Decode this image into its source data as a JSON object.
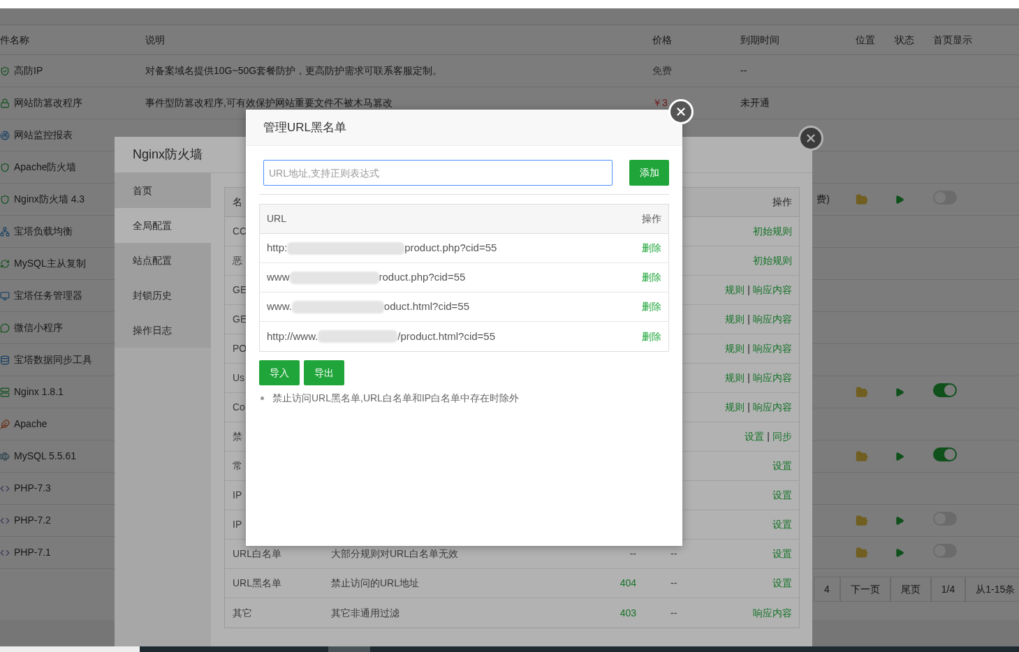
{
  "background_table": {
    "columns": [
      "件名称",
      "说明",
      "价格",
      "到期时间",
      "位置",
      "状态",
      "首页显示"
    ],
    "rows": [
      {
        "name": "高防IP",
        "description": "对备案域名提供10G~50G套餐防护，更高防护需求可联系客服定制。",
        "price": {
          "text": "免费",
          "paid": false
        },
        "expiry": "--",
        "installed": false
      },
      {
        "name": "网站防篡改程序",
        "description": "事件型防篡改程序,可有效保护网站重要文件不被木马篡改",
        "price": {
          "text": "￥3",
          "paid": true
        },
        "expiry": "未开通",
        "installed": false
      },
      {
        "name": "网站监控报表",
        "installed": false
      },
      {
        "name": "Apache防火墙",
        "installed": false
      },
      {
        "name": "Nginx防火墙 4.3",
        "expiry_tail": "费)",
        "installed": true,
        "home_display_on": false
      },
      {
        "name": "宝塔负载均衡",
        "installed": false
      },
      {
        "name": "MySQL主从复制",
        "installed": false
      },
      {
        "name": "宝塔任务管理器",
        "installed": false
      },
      {
        "name": "微信小程序",
        "installed": false
      },
      {
        "name": "宝塔数据同步工具",
        "installed": false
      },
      {
        "name": "Nginx 1.8.1",
        "installed": true,
        "home_display_on": true
      },
      {
        "name": "Apache",
        "installed": false
      },
      {
        "name": "MySQL 5.5.61",
        "installed": true,
        "home_display_on": true
      },
      {
        "name": "PHP-7.3",
        "installed": false
      },
      {
        "name": "PHP-7.2",
        "installed": true,
        "home_display_on": false
      },
      {
        "name": "PHP-7.1",
        "installed": true,
        "home_display_on": false
      }
    ]
  },
  "pagination": [
    {
      "label": "4"
    },
    {
      "label": "下一页"
    },
    {
      "label": "尾页"
    },
    {
      "label": "1/4"
    },
    {
      "label": "从1-15条"
    }
  ],
  "firewall_dialog": {
    "title": "Nginx防火墙",
    "nav": [
      {
        "label": "首页",
        "selected": false
      },
      {
        "label": "全局配置",
        "selected": true
      },
      {
        "label": "站点配置",
        "selected": false
      },
      {
        "label": "封锁历史",
        "selected": false
      },
      {
        "label": "操作日志",
        "selected": false
      }
    ],
    "table": {
      "name_header": "名",
      "actions_header": "操作",
      "action_separator": "|",
      "rows": [
        {
          "name": "CC",
          "actions": [
            "初始规则"
          ]
        },
        {
          "name": "恶",
          "actions": [
            "初始规则"
          ]
        },
        {
          "name": "GE",
          "actions": [
            "规则",
            "响应内容"
          ]
        },
        {
          "name": "GE",
          "actions": [
            "规则",
            "响应内容"
          ]
        },
        {
          "name": "PO",
          "actions": [
            "规则",
            "响应内容"
          ]
        },
        {
          "name": "Us",
          "actions": [
            "规则",
            "响应内容"
          ]
        },
        {
          "name": "Co",
          "actions": [
            "规则",
            "响应内容"
          ]
        },
        {
          "name": "禁",
          "actions": [
            "设置",
            "同步"
          ]
        },
        {
          "name": "常",
          "actions": [
            "设置"
          ]
        },
        {
          "name": "IP",
          "actions": [
            "设置"
          ]
        },
        {
          "name": "IP",
          "actions": [
            "设置"
          ]
        },
        {
          "name": "URL白名单",
          "description": "大部分规则对URL白名单无效",
          "code": "--",
          "code_active": false,
          "column_4": "--",
          "actions": [
            "设置"
          ]
        },
        {
          "name": "URL黑名单",
          "description": "禁止访问的URL地址",
          "code": "404",
          "code_active": true,
          "column_4": "--",
          "actions": [
            "设置"
          ]
        },
        {
          "name": "其它",
          "description": "其它非通用过滤",
          "code": "403",
          "code_active": true,
          "column_4": "--",
          "actions": [
            "响应内容"
          ]
        }
      ]
    }
  },
  "url_blacklist_dialog": {
    "title": "管理URL黑名单",
    "url_input": {
      "placeholder": "URL地址,支持正则表达式"
    },
    "add_button": "添加",
    "table": {
      "columns": [
        "URL",
        "操作"
      ],
      "rows": [
        {
          "url_start": "http:",
          "url_end": "product.php?cid=55",
          "action": "删除"
        },
        {
          "url_start": "www",
          "url_end": "roduct.php?cid=55",
          "action": "删除"
        },
        {
          "url_start": "www.",
          "url_end": "oduct.html?cid=55",
          "action": "删除"
        },
        {
          "url_start": "http://www.",
          "url_end": "/product.html?cid=55",
          "action": "删除"
        }
      ]
    },
    "buttons": [
      "导入",
      "导出"
    ],
    "notes": [
      "禁止访问URL黑名单,URL白名单和IP白名单中存在时除外"
    ]
  }
}
